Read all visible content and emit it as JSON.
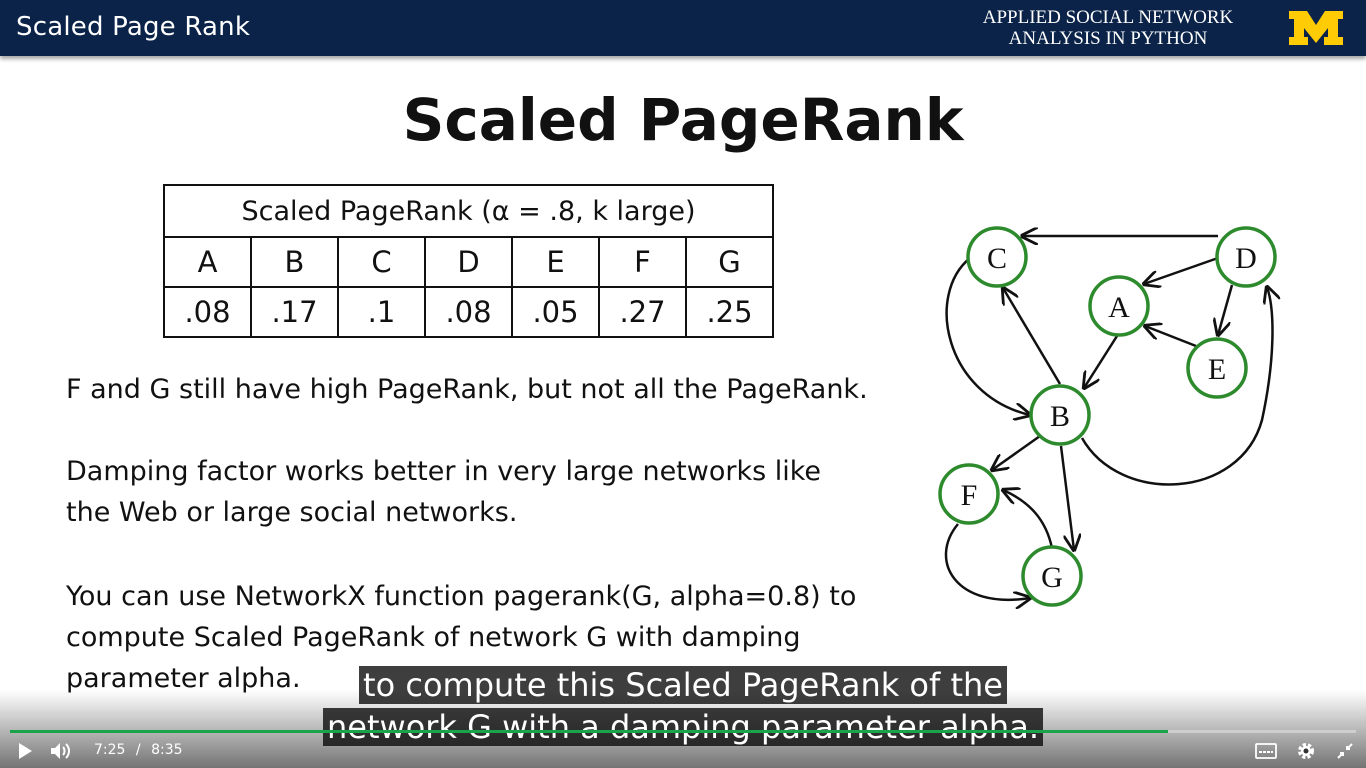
{
  "header": {
    "title": "Scaled Page Rank",
    "course_line1": "APPLIED SOCIAL NETWORK",
    "course_line2": "ANALYSIS IN PYTHON",
    "logo_colors": {
      "gold": "#FFCB05"
    }
  },
  "slide": {
    "title": "Scaled PageRank",
    "table": {
      "caption": "Scaled PageRank (α = .8, k large)",
      "headers": [
        "A",
        "B",
        "C",
        "D",
        "E",
        "F",
        "G"
      ],
      "values": [
        ".08",
        ".17",
        ".1",
        ".08",
        ".05",
        ".27",
        ".25"
      ]
    },
    "paragraphs": [
      "F and G still have high PageRank, but not all the PageRank.",
      "Damping factor works better in very large networks like",
      "the Web or large social networks.",
      "You can use NetworkX function pagerank(G, alpha=0.8) to",
      "compute Scaled PageRank of network G with damping",
      "parameter alpha."
    ],
    "graph": {
      "nodes": [
        "C",
        "D",
        "A",
        "E",
        "B",
        "F",
        "G"
      ],
      "edge_color": "#111111",
      "node_border_color": "#2d8a2d"
    }
  },
  "player": {
    "subtitle_line1": "to compute this Scaled PageRank of the",
    "subtitle_line2": "network G with a damping parameter alpha.",
    "current_time": "7:25",
    "separator": "/",
    "duration": "8:35",
    "progress": 0.86,
    "accent": "#1aa34a",
    "icons": [
      "play-icon",
      "volume-icon",
      "captions-icon",
      "settings-icon",
      "exit-fullscreen-icon"
    ]
  }
}
